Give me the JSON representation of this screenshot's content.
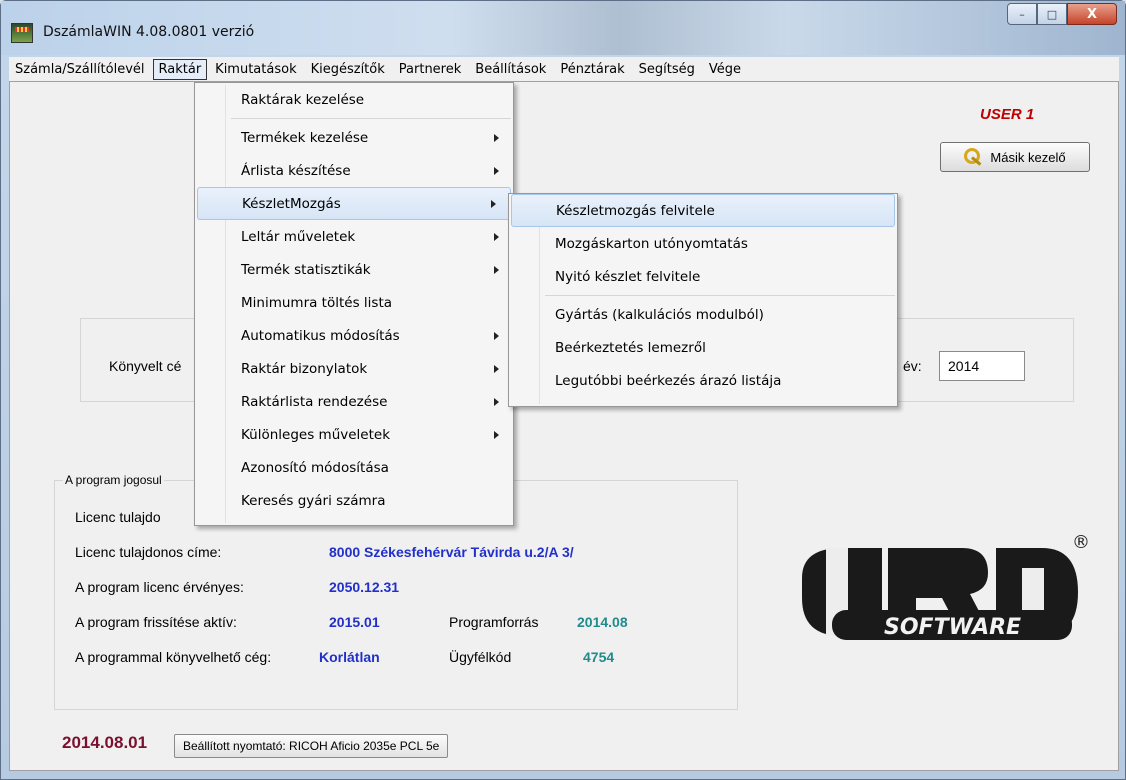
{
  "window": {
    "title": "DszámlaWIN 4.08.0801 verzió"
  },
  "window_controls": {
    "minimize": "–",
    "maximize": "□",
    "close": "X"
  },
  "menubar": [
    {
      "label": "Számla/Szállítólevél"
    },
    {
      "label": "Raktár"
    },
    {
      "label": "Kimutatások"
    },
    {
      "label": "Kiegészítők"
    },
    {
      "label": "Partnerek"
    },
    {
      "label": "Beállítások"
    },
    {
      "label": "Pénztárak"
    },
    {
      "label": "Segítség"
    },
    {
      "label": "Vége"
    }
  ],
  "raktar_menu": [
    {
      "label": "Raktárak kezelése",
      "submenu": false
    },
    {
      "label": "Termékek kezelése",
      "submenu": true
    },
    {
      "label": "Árlista készítése",
      "submenu": true
    },
    {
      "label": "KészletMozgás",
      "submenu": true
    },
    {
      "label": "Leltár műveletek",
      "submenu": true
    },
    {
      "label": "Termék statisztikák",
      "submenu": true
    },
    {
      "label": "Minimumra töltés lista",
      "submenu": false
    },
    {
      "label": "Automatikus módosítás",
      "submenu": true
    },
    {
      "label": "Raktár bizonylatok",
      "submenu": true
    },
    {
      "label": "Raktárlista rendezése",
      "submenu": true
    },
    {
      "label": "Különleges műveletek",
      "submenu": true
    },
    {
      "label": "Azonosító módosítása",
      "submenu": false
    },
    {
      "label": "Keresés gyári számra",
      "submenu": false
    }
  ],
  "keszletmozgas_submenu": [
    {
      "label": "Készletmozgás felvitele"
    },
    {
      "label": "Mozgáskarton utónyomtatás"
    },
    {
      "label": "Nyitó készlet felvitele"
    },
    {
      "label": "Gyártás (kalkulációs modulból)"
    },
    {
      "label": "Beérkeztetés lemezről"
    },
    {
      "label": "Legutóbbi beérkezés árazó listája"
    }
  ],
  "user": {
    "name": "USER 1",
    "switch_button": "Másik kezelő"
  },
  "company": {
    "label": "Könyvelt cé",
    "year_label": "év:",
    "year_value": "2014"
  },
  "license": {
    "group_title": "A program jogosul",
    "owner_label": "Licenc tulajdo",
    "address_label": "Licenc tulajdonos címe:",
    "address_value": "8000 Székesfehérvár Távirda u.2/A 3/",
    "valid_label": "A program licenc érvényes:",
    "valid_value": "2050.12.31",
    "update_label": "A program frissítése aktív:",
    "update_value": "2015.01",
    "source_label": "Programforrás",
    "source_value": "2014.08",
    "companies_label": "A programmal könyvelhető cég:",
    "companies_value": "Korlátlan",
    "client_label": "Ügyfélkód",
    "client_value": "4754"
  },
  "logo": {
    "text": "SOFTWARE",
    "registered": "®"
  },
  "footer": {
    "date": "2014.08.01",
    "printer_button": "Beállított nyomtató: RICOH Aficio 2035e PCL 5e"
  },
  "colors": {
    "user": "#c00000",
    "license_value": "#2230c8",
    "source_value": "#1f8c8a",
    "date": "#7a1030"
  }
}
